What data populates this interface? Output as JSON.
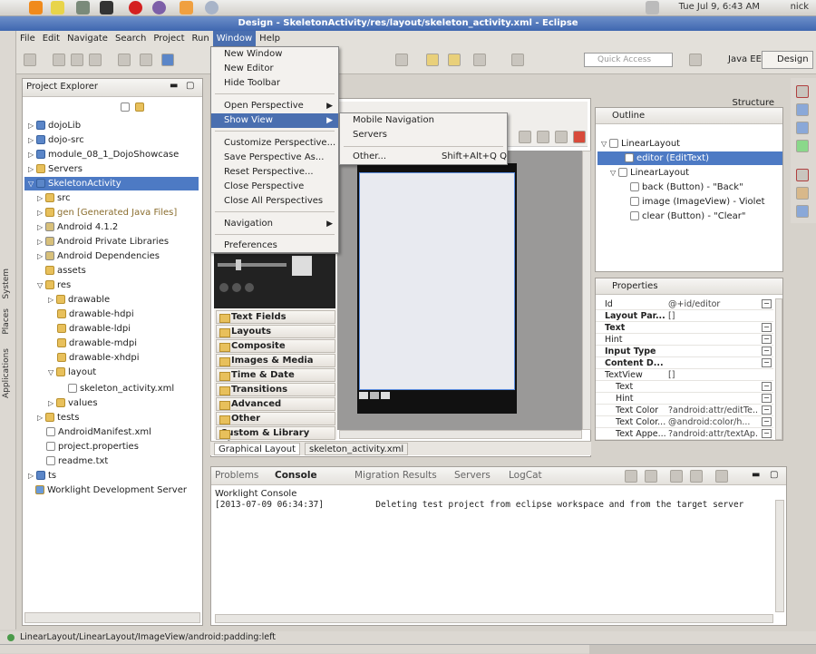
{
  "system": {
    "clock": "Tue Jul 9,  6:43 AM",
    "user": "nick",
    "side_labels": [
      "System",
      "Places",
      "Applications"
    ]
  },
  "window": {
    "title": "Design - SkeletonActivity/res/layout/skeleton_activity.xml - Eclipse"
  },
  "menubar": [
    "File",
    "Edit",
    "Navigate",
    "Search",
    "Project",
    "Run",
    "Window",
    "Help"
  ],
  "toolbar": {
    "quick_access": "Quick Access",
    "perspective_java_ee": "Java EE",
    "perspective_design": "Design"
  },
  "window_menu": {
    "items": [
      {
        "label": "New Window"
      },
      {
        "label": "New Editor"
      },
      {
        "label": "Hide Toolbar"
      },
      {
        "label": "Open Perspective"
      },
      {
        "label": "Show View"
      },
      {
        "label": "Customize Perspective..."
      },
      {
        "label": "Save Perspective As..."
      },
      {
        "label": "Reset Perspective..."
      },
      {
        "label": "Close Perspective"
      },
      {
        "label": "Close All Perspectives"
      },
      {
        "label": "Navigation"
      },
      {
        "label": "Preferences"
      }
    ]
  },
  "show_view_menu": {
    "items": [
      {
        "label": "Mobile Navigation"
      },
      {
        "label": "Servers"
      },
      {
        "label": "Other...",
        "shortcut": "Shift+Alt+Q Q"
      }
    ]
  },
  "project_explorer": {
    "title": "Project Explorer",
    "items": [
      {
        "label": "dojoLib"
      },
      {
        "label": "dojo-src"
      },
      {
        "label": "module_08_1_DojoShowcase"
      },
      {
        "label": "Servers"
      },
      {
        "label": "SkeletonActivity"
      },
      {
        "label": "src"
      },
      {
        "label": "gen [Generated Java Files]"
      },
      {
        "label": "Android 4.1.2"
      },
      {
        "label": "Android Private Libraries"
      },
      {
        "label": "Android Dependencies"
      },
      {
        "label": "assets"
      },
      {
        "label": "res"
      },
      {
        "label": "drawable"
      },
      {
        "label": "drawable-hdpi"
      },
      {
        "label": "drawable-ldpi"
      },
      {
        "label": "drawable-mdpi"
      },
      {
        "label": "drawable-xhdpi"
      },
      {
        "label": "layout"
      },
      {
        "label": "skeleton_activity.xml"
      },
      {
        "label": "values"
      },
      {
        "label": "tests"
      },
      {
        "label": "AndroidManifest.xml"
      },
      {
        "label": "project.properties"
      },
      {
        "label": "readme.txt"
      },
      {
        "label": "ts"
      },
      {
        "label": "Worklight Development Server"
      }
    ]
  },
  "palette": {
    "sections": [
      "Text Fields",
      "Layouts",
      "Composite",
      "Images & Media",
      "Time & Date",
      "Transitions",
      "Advanced",
      "Other",
      "Custom & Library Views"
    ]
  },
  "editor": {
    "tabs": [
      "Graphical Layout",
      "skeleton_activity.xml"
    ]
  },
  "outline": {
    "header": "Structure",
    "title": "Outline",
    "items": [
      {
        "label": "LinearLayout"
      },
      {
        "label": "editor (EditText)"
      },
      {
        "label": "LinearLayout"
      },
      {
        "label": "back (Button) - \"Back\""
      },
      {
        "label": "image (ImageView) - Violet"
      },
      {
        "label": "clear (Button) - \"Clear\""
      }
    ]
  },
  "properties": {
    "title": "Properties",
    "rows": [
      {
        "key": "Id",
        "value": "@+id/editor"
      },
      {
        "key": "Layout Par...",
        "value": "[]"
      },
      {
        "key": "Text",
        "value": ""
      },
      {
        "key": "Hint",
        "value": ""
      },
      {
        "key": "Input Type",
        "value": ""
      },
      {
        "key": "Content D...",
        "value": ""
      },
      {
        "key": "TextView",
        "value": "[]"
      },
      {
        "key": "Text",
        "value": ""
      },
      {
        "key": "Hint",
        "value": ""
      },
      {
        "key": "Text Color",
        "value": "?android:attr/editTe..."
      },
      {
        "key": "Text Color...",
        "value": "@android:color/h..."
      },
      {
        "key": "Text Appe...",
        "value": "?android:attr/textAp..."
      }
    ]
  },
  "console": {
    "tabs": [
      "Problems",
      "Console",
      "Migration Results",
      "Servers",
      "LogCat"
    ],
    "subtitle": "Worklight Console",
    "line": "[2013-07-09 06:34:37]          Deleting test project from eclipse workspace and from the target server"
  },
  "statusbar": {
    "text": "LinearLayout/LinearLayout/ImageView/android:padding:left"
  }
}
